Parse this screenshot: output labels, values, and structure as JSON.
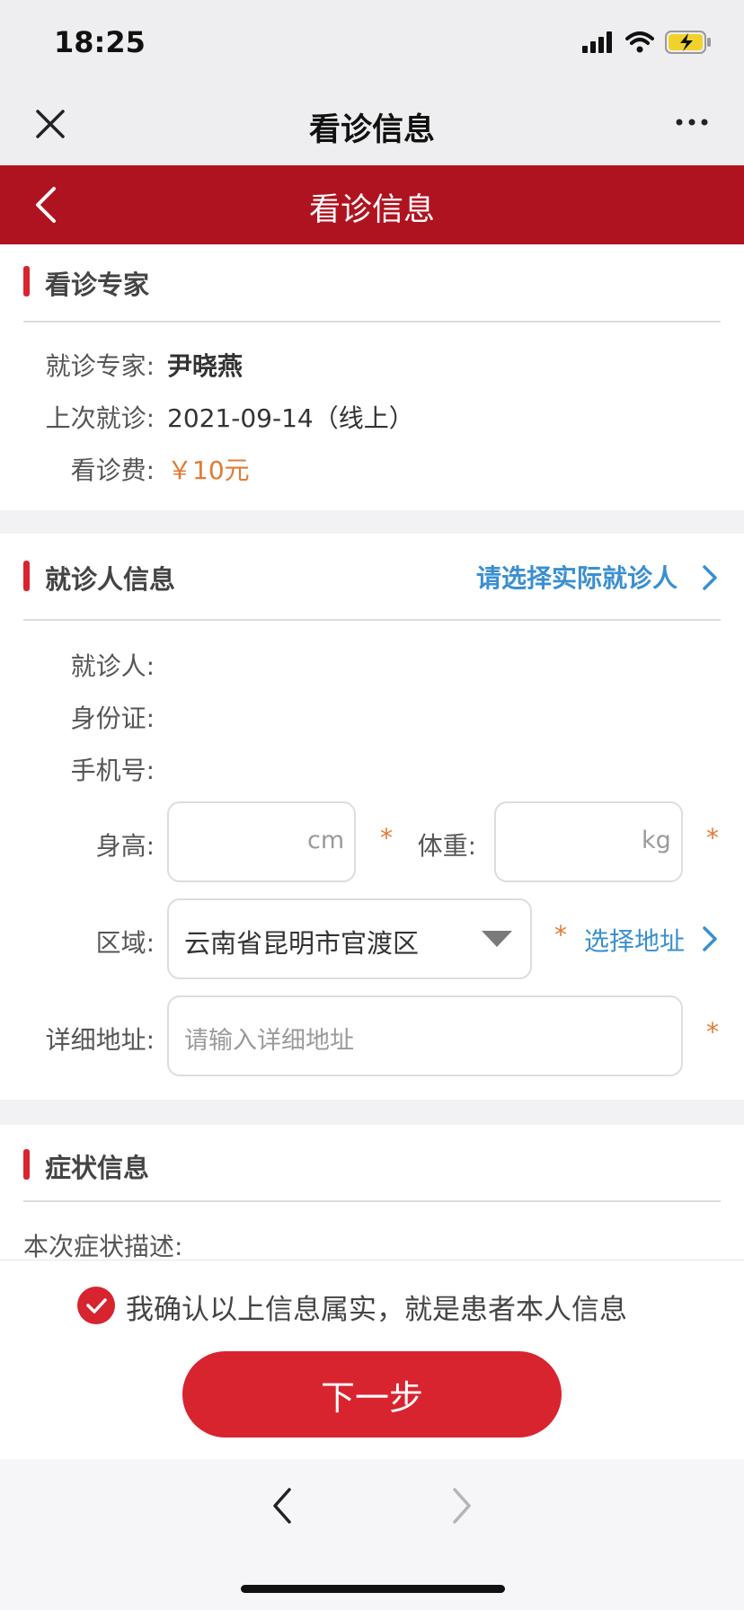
{
  "status": {
    "time": "18:25"
  },
  "wechat": {
    "title": "看诊信息"
  },
  "header": {
    "title": "看诊信息"
  },
  "expert": {
    "section_title": "看诊专家",
    "doctor_label": "就诊专家:",
    "doctor_name": "尹晓燕",
    "last_label": "上次就诊:",
    "last_value": "2021-09-14（线上）",
    "fee_label": "看诊费:",
    "fee_value": "￥10元"
  },
  "patient": {
    "section_title": "就诊人信息",
    "select_link": "请选择实际就诊人",
    "name_label": "就诊人:",
    "id_label": "身份证:",
    "phone_label": "手机号:",
    "height_label": "身高:",
    "height_unit": "cm",
    "weight_label": "体重:",
    "weight_unit": "kg",
    "required": "*",
    "region_label": "区域:",
    "region_value": "云南省昆明市官渡区",
    "choose_address": "选择地址",
    "address_label": "详细地址:",
    "address_placeholder": "请输入详细地址"
  },
  "symptom": {
    "section_title": "症状信息",
    "desc_label": "本次症状描述:"
  },
  "footer": {
    "confirm_text": "我确认以上信息属实，就是患者本人信息",
    "next_button": "下一步"
  },
  "colors": {
    "brand_red": "#b01320",
    "button_red": "#d8242f",
    "orange": "#e07b34",
    "link_blue": "#3a8fd0"
  }
}
